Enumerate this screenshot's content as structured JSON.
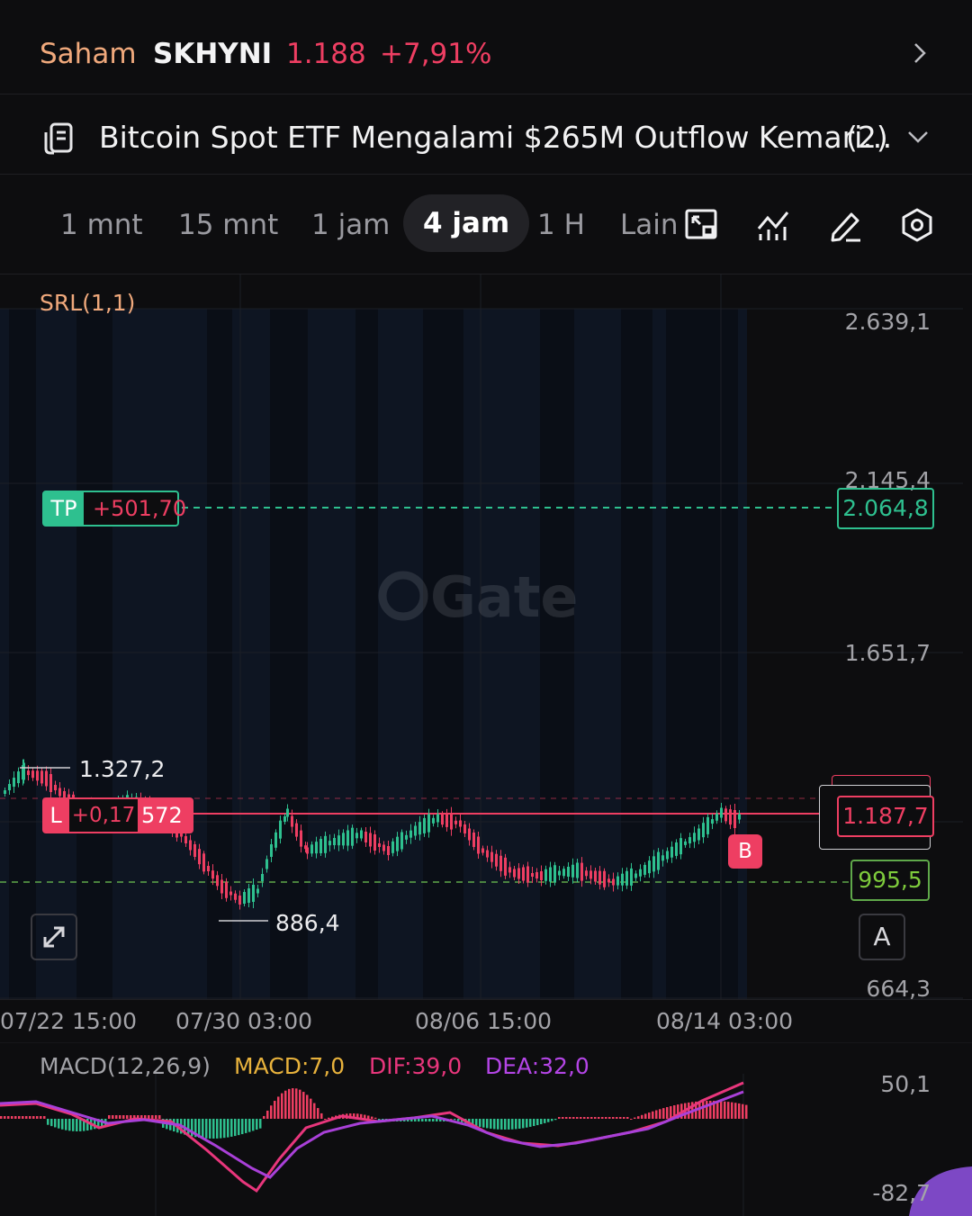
{
  "header": {
    "category": "Saham",
    "symbol": "SKHYNI",
    "price": "1.188",
    "change": "+7,91%"
  },
  "news": {
    "title": "Bitcoin Spot ETF Mengalami $265M Outflow Kemari…",
    "count": "(2)"
  },
  "timeframes": {
    "tabs": [
      "1 mnt",
      "15 mnt",
      "1 jam",
      "4 jam",
      "1 H",
      "Lain"
    ],
    "active": "4 jam"
  },
  "toolbar": {
    "icons": [
      "fullscreen-toggle-icon",
      "indicator-icon",
      "draw-icon",
      "settings-icon"
    ]
  },
  "chart": {
    "indicator_label": "SRL(1,1)",
    "watermark": "Gate",
    "y_axis_labels": [
      "2.639,1",
      "2.145,4",
      "1.651,7",
      "664,3"
    ],
    "x_axis_labels": [
      "07/22 15:00",
      "07/30 03:00",
      "08/06 15:00",
      "08/14 03:00"
    ],
    "high_label": "1.327,2",
    "low_label": "886,4",
    "tp": {
      "tag": "TP",
      "pnl": "+501,70",
      "price": "2.064,8"
    },
    "position": {
      "side": "L",
      "pnl": "+0,17",
      "qty": "572",
      "price": "1.187,7"
    },
    "sl_price": "995,5",
    "buy_marker": "B",
    "auto_button": "A",
    "colors": {
      "up": "#2ec08f",
      "down": "#ee3e62",
      "tp": "#2ec08f",
      "sl": "#7ecb3c"
    }
  },
  "macd": {
    "title": "MACD(12,26,9)",
    "macd_label": "MACD:7,0",
    "dif_label": "DIF:39,0",
    "dea_label": "DEA:32,0",
    "y_top": "50,1",
    "y_bottom": "-82,7"
  }
}
